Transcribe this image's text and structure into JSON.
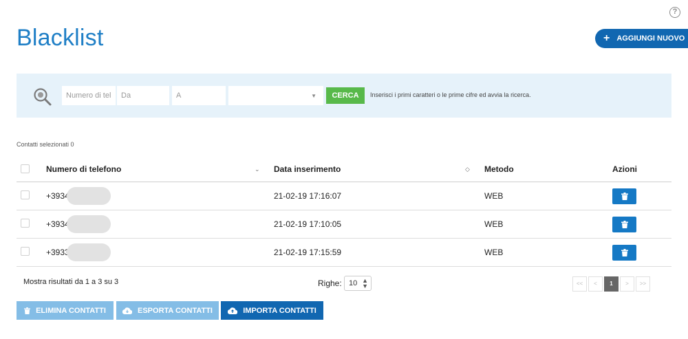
{
  "header": {
    "title": "Blacklist",
    "add_new_label": "AGGIUNGI NUOVO",
    "help_label": "?"
  },
  "search": {
    "phone_placeholder": "Numero di tel",
    "from_placeholder": "Da",
    "to_placeholder": "A",
    "select_value": "",
    "button_label": "CERCA",
    "hint": "Inserisci i primi caratteri o le prime cifre ed avvia la ricerca."
  },
  "selection": {
    "label": "Contatti selezionati 0"
  },
  "table": {
    "columns": {
      "phone": "Numero di telefono",
      "date": "Data inserimento",
      "method": "Metodo",
      "actions": "Azioni"
    },
    "rows": [
      {
        "phone": "+3934",
        "date": "21-02-19 17:16:07",
        "method": "WEB"
      },
      {
        "phone": "+3934",
        "date": "21-02-19 17:10:05",
        "method": "WEB"
      },
      {
        "phone": "+3933",
        "date": "21-02-19 17:15:59",
        "method": "WEB"
      }
    ]
  },
  "footer": {
    "results_text": "Mostra risultati da 1 a 3 su 3",
    "rows_label": "Righe:",
    "rows_value": "10",
    "pager": {
      "first": "<<",
      "prev": "<",
      "current": "1",
      "next": ">",
      "last": ">>"
    }
  },
  "actions": {
    "delete_label": "ELIMINA CONTATTI",
    "export_label": "ESPORTA CONTATTI",
    "import_label": "IMPORTA CONTATTI"
  },
  "colors": {
    "accent": "#1f7fc6",
    "primary_button": "#1167b1",
    "disabled_button": "#84bde6",
    "search_button": "#58b94a",
    "search_bar_bg": "#e6f2fa"
  }
}
